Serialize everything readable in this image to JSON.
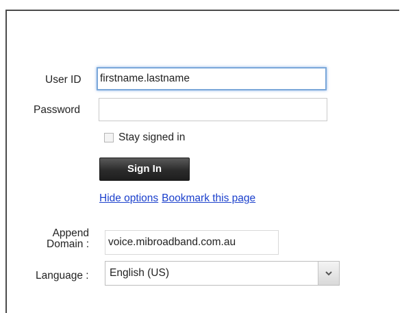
{
  "login": {
    "user_id_label": "User ID",
    "user_id_value": "firstname.lastname",
    "password_label": "Password",
    "password_value": "",
    "stay_signed_in_label": "Stay signed in",
    "stay_signed_in_checked": false,
    "sign_in_label": "Sign In"
  },
  "links": {
    "hide_options": "Hide options",
    "bookmark": "Bookmark this page"
  },
  "options": {
    "append_domain_label_line1": "Append",
    "append_domain_label_line2": "Domain :",
    "append_domain_value": "voice.mibroadband.com.au",
    "language_label": "Language :",
    "language_value": "English (US)"
  },
  "icons": {
    "language_dropdown": "chevron-down-icon"
  },
  "colors": {
    "link": "#1a3fcc",
    "focus_ring": "#7aa7d9",
    "sign_in_bg": "#2b2b2b"
  }
}
